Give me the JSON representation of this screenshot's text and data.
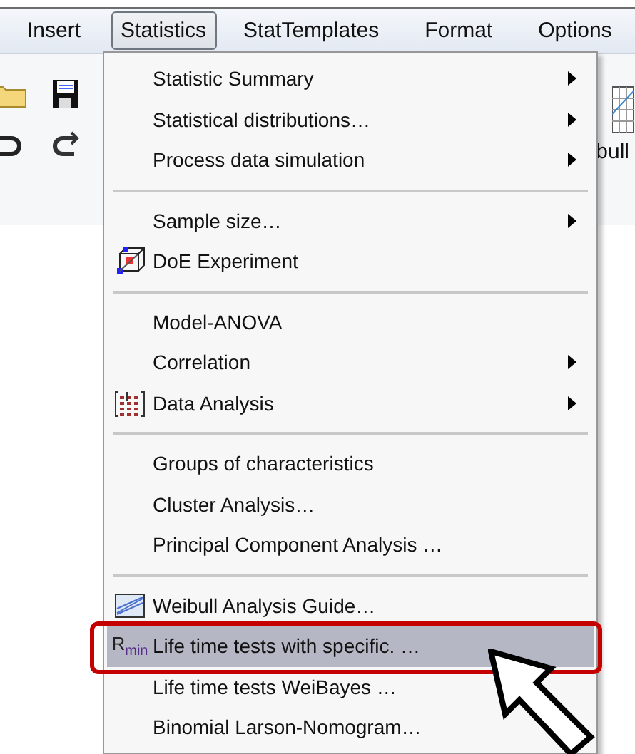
{
  "menubar": [
    {
      "label": "Insert",
      "selected": false
    },
    {
      "label": "Statistics",
      "selected": true
    },
    {
      "label": "StatTemplates",
      "selected": false
    },
    {
      "label": "Format",
      "selected": false
    },
    {
      "label": "Options",
      "selected": false
    }
  ],
  "toolbar": {
    "partial_label": "bull"
  },
  "menu": [
    {
      "kind": "item",
      "label": "Statistic Summary",
      "submenu": true,
      "selected": false
    },
    {
      "kind": "item",
      "label": "Statistical distributions…",
      "submenu": true,
      "selected": false
    },
    {
      "kind": "item",
      "label": "Process data simulation",
      "submenu": true,
      "selected": false
    },
    {
      "kind": "separator"
    },
    {
      "kind": "item",
      "label": "Sample size…",
      "submenu": true,
      "selected": false
    },
    {
      "kind": "item",
      "label": "DoE Experiment",
      "submenu": false,
      "selected": false
    },
    {
      "kind": "separator"
    },
    {
      "kind": "item",
      "label": "Model-ANOVA",
      "submenu": false,
      "selected": false
    },
    {
      "kind": "item",
      "label": "Correlation",
      "submenu": true,
      "selected": false
    },
    {
      "kind": "item",
      "label": "Data Analysis",
      "submenu": true,
      "selected": false
    },
    {
      "kind": "separator"
    },
    {
      "kind": "item",
      "label": "Groups of characteristics",
      "submenu": false,
      "selected": false
    },
    {
      "kind": "item",
      "label": "Cluster Analysis…",
      "submenu": false,
      "selected": false
    },
    {
      "kind": "item",
      "label": "Principal Component Analysis …",
      "submenu": false,
      "selected": false
    },
    {
      "kind": "separator"
    },
    {
      "kind": "item",
      "label": "Weibull Analysis Guide…",
      "submenu": false,
      "selected": false
    },
    {
      "kind": "item",
      "label": "Life time tests with specific. …",
      "submenu": false,
      "selected": true,
      "outlined": true,
      "icon_label": "R$_{min}$"
    },
    {
      "kind": "item",
      "label": "Life time tests WeiBayes …",
      "submenu": false,
      "selected": false
    },
    {
      "kind": "item",
      "label": "Binomial Larson-Nomogram…",
      "submenu": false,
      "selected": false
    }
  ]
}
